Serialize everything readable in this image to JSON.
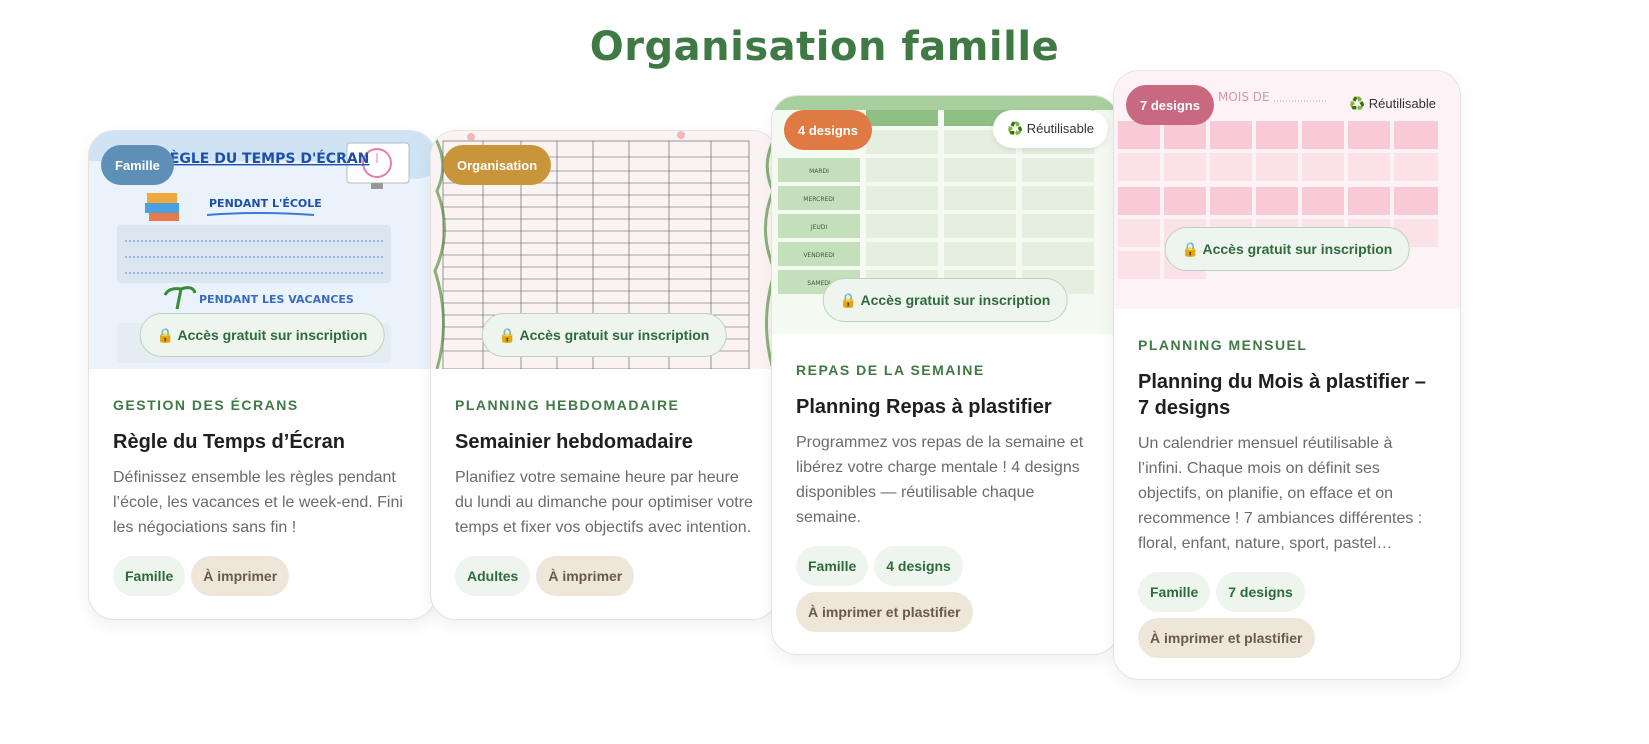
{
  "page": {
    "title": "Organisation famille"
  },
  "colors": {
    "title": "#3f7a45",
    "badge_famille": "#5e8fb6",
    "badge_organisation": "#c9953a",
    "badge_4designs": "#e07a43",
    "badge_7designs": "#c9697f"
  },
  "cards": [
    {
      "badge": "Famille",
      "thumbnail_heading": "RÈGLE DU TEMPS D'ÉCRAN",
      "thumbnail_sub1": "PENDANT L'ÉCOLE",
      "thumbnail_sub2": "PENDANT LES VACANCES",
      "access": "🔒 Accès gratuit sur inscription",
      "category": "GESTION DES ÉCRANS",
      "title": "Règle du Temps d’Écran",
      "description": "Définissez ensemble les règles pendant l’école, les vacances et le week-end. Fini les négociations sans fin !",
      "tags": [
        "Famille",
        "À imprimer"
      ]
    },
    {
      "badge": "Organisation",
      "access": "🔒 Accès gratuit sur inscription",
      "category": "PLANNING HEBDOMADAIRE",
      "title": "Semainier hebdomadaire",
      "description": "Planifiez votre semaine heure par heure du lundi au dimanche pour optimiser votre temps et fixer vos objectifs avec intention.",
      "tags": [
        "Adultes",
        "À imprimer"
      ]
    },
    {
      "badge": "4 designs",
      "reuse": "♻️ Réutilisable",
      "thumbnail_days": [
        "MARDI",
        "MERCREDI",
        "JEUDI",
        "VENDREDI",
        "SAMEDI"
      ],
      "access": "🔒 Accès gratuit sur inscription",
      "category": "REPAS DE LA SEMAINE",
      "title": "Planning Repas à plastifier",
      "description": "Programmez vos repas de la semaine et libérez votre charge mentale ! 4 designs disponibles — réutilisable chaque semaine.",
      "tags": [
        "Famille",
        "4 designs",
        "À imprimer et plastifier"
      ]
    },
    {
      "badge": "7 designs",
      "reuse": "♻️ Réutilisable",
      "thumbnail_heading": "MOIS DE",
      "access": "🔒 Accès gratuit sur inscription",
      "category": "PLANNING MENSUEL",
      "title": "Planning du Mois à plastifier – 7 designs",
      "description": "Un calendrier mensuel réutilisable à l’infini. Chaque mois on définit ses objectifs, on planifie, on efface et on recommence ! 7 ambiances différentes : floral, enfant, nature, sport, pastel…",
      "tags": [
        "Famille",
        "7 designs",
        "À imprimer et plastifier"
      ]
    }
  ]
}
